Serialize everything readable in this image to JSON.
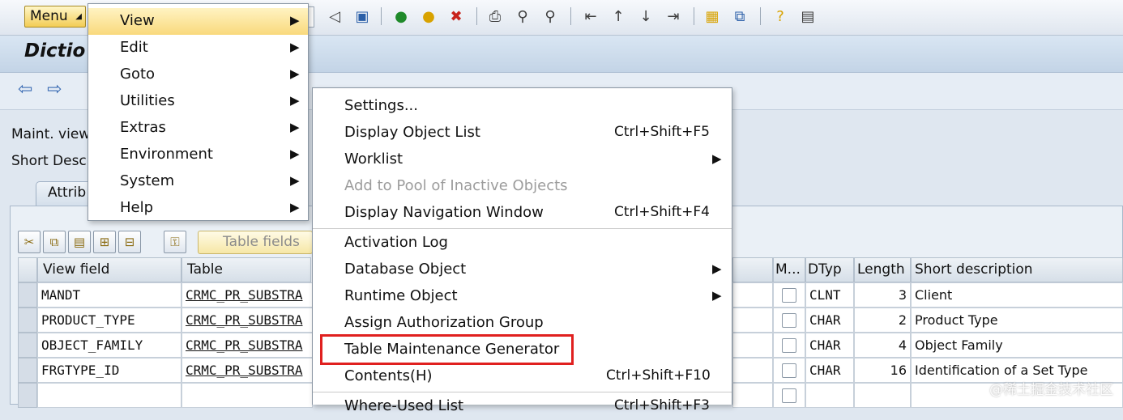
{
  "toolbar": {
    "menu_label": "Menu",
    "icons": [
      "back-icon",
      "save-icon",
      "green-back-icon",
      "exit-icon",
      "cancel-icon",
      "print-icon",
      "find-icon",
      "find-next-icon",
      "first-page-icon",
      "previous-page-icon",
      "next-page-icon",
      "last-page-icon",
      "create-session-icon",
      "shortcut-icon",
      "help-icon",
      "customize-layout-icon"
    ]
  },
  "title": {
    "text": "Dictio"
  },
  "form": {
    "maint_view_label": "Maint. view",
    "short_desc_label": "Short Desc",
    "tab_label": "Attrib",
    "table_fields_label": "Table fields"
  },
  "main_menu": {
    "items": [
      {
        "label": "View",
        "submenu": true,
        "highlighted": true
      },
      {
        "label": "Edit",
        "submenu": true
      },
      {
        "label": "Goto",
        "submenu": true
      },
      {
        "label": "Utilities",
        "submenu": true
      },
      {
        "label": "Extras",
        "submenu": true
      },
      {
        "label": "Environment",
        "submenu": true
      },
      {
        "label": "System",
        "submenu": true
      },
      {
        "label": "Help",
        "submenu": true
      }
    ]
  },
  "sub_menu": {
    "items": [
      {
        "label": "Settings...",
        "shortcut": ""
      },
      {
        "label": "Display Object List",
        "shortcut": "Ctrl+Shift+F5"
      },
      {
        "label": "Worklist",
        "shortcut": "",
        "submenu": true
      },
      {
        "label": "Add to Pool of Inactive Objects",
        "shortcut": "",
        "disabled": true
      },
      {
        "label": "Display Navigation Window",
        "shortcut": "Ctrl+Shift+F4"
      },
      {
        "label": "Activation Log",
        "shortcut": ""
      },
      {
        "label": "Database Object",
        "shortcut": "",
        "submenu": true
      },
      {
        "label": "Runtime Object",
        "shortcut": "",
        "submenu": true
      },
      {
        "label": "Assign Authorization Group",
        "shortcut": ""
      },
      {
        "label": "Table Maintenance Generator",
        "shortcut": "",
        "outlined": true
      },
      {
        "label": "Contents(H)",
        "shortcut": "Ctrl+Shift+F10"
      },
      {
        "label": "Where-Used List",
        "shortcut": "Ctrl+Shift+F3"
      }
    ]
  },
  "table": {
    "headers": {
      "view_field": "View field",
      "table": "Table",
      "mod": "M...",
      "dtyp": "DTyp",
      "length": "Length",
      "short_description": "Short description"
    },
    "rows": [
      {
        "view_field": "MANDT",
        "table": "CRMC_PR_SUBSTRA",
        "dtyp": "CLNT",
        "length": "3",
        "desc": "Client"
      },
      {
        "view_field": "PRODUCT_TYPE",
        "table": "CRMC_PR_SUBSTRA",
        "dtyp": "CHAR",
        "length": "2",
        "desc": "Product Type"
      },
      {
        "view_field": "OBJECT_FAMILY",
        "table": "CRMC_PR_SUBSTRA",
        "dtyp": "CHAR",
        "length": "4",
        "desc": "Object Family"
      },
      {
        "view_field": "FRGTYPE_ID",
        "table": "CRMC_PR_SUBSTRA",
        "dtyp": "CHAR",
        "length": "16",
        "desc": "Identification of a Set Type"
      }
    ]
  },
  "watermark": "@稀土掘金技术社区"
}
